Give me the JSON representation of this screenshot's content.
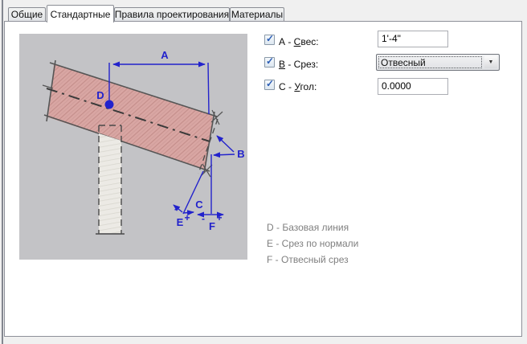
{
  "colors": {
    "accent_blue": "#2222cc",
    "legend_gray": "#7f7f7f",
    "sketch_pencil": "#555555"
  },
  "icons": {
    "check": "✓",
    "dropdown_arrow": "▼"
  },
  "tabs": [
    {
      "label": "Общие"
    },
    {
      "label": "Стандартные"
    },
    {
      "label": "Правила проектирования"
    },
    {
      "label": "Материалы"
    }
  ],
  "form": {
    "rows": [
      {
        "checked": true,
        "label_pre": "А - ",
        "label_accel": "С",
        "label_post": "вес:",
        "value": "1'-4\""
      },
      {
        "checked": true,
        "label_pre": "",
        "label_accel": "В",
        "label_post": " - Срез:",
        "value": "Отвесный"
      },
      {
        "checked": true,
        "label_pre": "С - ",
        "label_accel": "У",
        "label_post": "гол:",
        "value": "0.0000"
      }
    ]
  },
  "legend": {
    "items": [
      "D - Базовая линия",
      "E - Срез по нормали",
      "F - Отвесный срез"
    ]
  },
  "diagram": {
    "labels": {
      "a": "A",
      "b": "B",
      "c": "C",
      "d": "D",
      "e": "E",
      "f": "F"
    },
    "signs": {
      "plus": "+",
      "minus": "-"
    }
  }
}
